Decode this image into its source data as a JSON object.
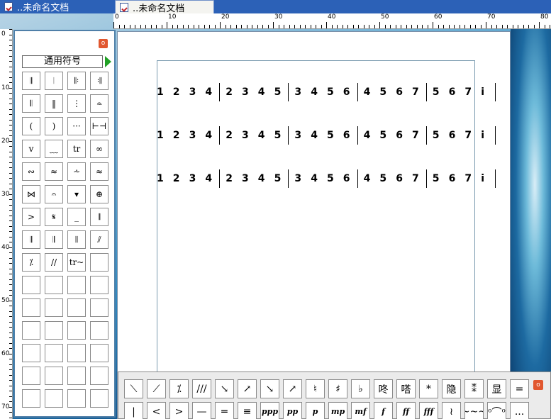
{
  "tabs": [
    {
      "label": "..未命名文档",
      "active": false
    },
    {
      "label": "..未命名文档",
      "active": true
    }
  ],
  "ruler": {
    "horizontal": [
      "0",
      "10",
      "20",
      "30",
      "40",
      "50",
      "60",
      "70",
      "80"
    ],
    "vertical": [
      "0",
      "10",
      "20",
      "30",
      "40",
      "50",
      "60",
      "70"
    ]
  },
  "palette": {
    "close_label": "o",
    "category": "通用符号",
    "symbols": [
      "𝄂",
      "𝄀",
      "𝄆",
      "𝄇",
      "𝄃",
      "‖",
      "⋮",
      "𝄐̶",
      "(",
      ")",
      "···",
      "⊢⊣",
      "v",
      "﹏",
      "tr",
      "∞",
      "∾",
      "≈",
      "⩪",
      "≈",
      "⋈",
      "𝄐",
      "▾",
      "⊕",
      ">",
      "𝄋",
      "_",
      "𝄂",
      "𝄂",
      "𝄂",
      "𝄂",
      "⫽",
      "⁒",
      "//",
      "tr~",
      "",
      "",
      "",
      "",
      "",
      "",
      "",
      "",
      "",
      "",
      "",
      "",
      "",
      "",
      "",
      "",
      "",
      "",
      "",
      "",
      "",
      "",
      "",
      "",
      ""
    ]
  },
  "score": {
    "rows": [
      [
        "1",
        "2",
        "3",
        "4",
        "|",
        "2",
        "3",
        "4",
        "5",
        "|",
        "3",
        "4",
        "5",
        "6",
        "|",
        "4",
        "5",
        "6",
        "7",
        "|",
        "5",
        "6",
        "7",
        "i",
        "|"
      ],
      [
        "1",
        "2",
        "3",
        "4",
        "|",
        "2",
        "3",
        "4",
        "5",
        "|",
        "3",
        "4",
        "5",
        "6",
        "|",
        "4",
        "5",
        "6",
        "7",
        "|",
        "5",
        "6",
        "7",
        "i",
        "|"
      ],
      [
        "1",
        "2",
        "3",
        "4",
        "|",
        "2",
        "3",
        "4",
        "5",
        "|",
        "3",
        "4",
        "5",
        "6",
        "|",
        "4",
        "5",
        "6",
        "7",
        "|",
        "5",
        "6",
        "7",
        "i",
        "|"
      ]
    ]
  },
  "toolbar": {
    "close_label": "o",
    "row1": [
      "⟍",
      "⟋",
      "⁒",
      "///",
      "↘",
      "↗",
      "↘",
      "↗",
      "♮",
      "♯",
      "♭",
      "咚",
      "嗒",
      "*",
      "隐",
      "⁑",
      "显",
      "="
    ],
    "row2": [
      "|",
      "<",
      ">",
      "—",
      "═",
      "≡",
      "ppp",
      "pp",
      "p",
      "mp",
      "mf",
      "f",
      "ff",
      "fff",
      "≀",
      "~~~",
      "ᵒ⌒ᵒ",
      "..."
    ]
  }
}
